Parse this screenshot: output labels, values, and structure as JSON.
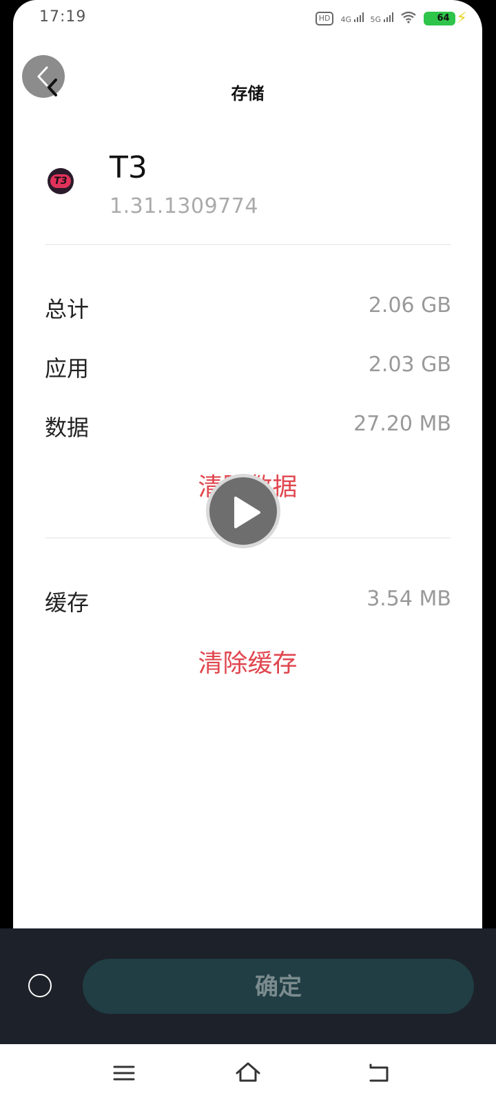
{
  "status_bar": {
    "time": "17:19",
    "hd_label": "HD",
    "signal1_label": "4G",
    "signal2_label": "5G",
    "battery_level": "64"
  },
  "header": {
    "title": "存储"
  },
  "app": {
    "name": "T3",
    "version": "1.31.1309774",
    "icon_text": "T3"
  },
  "storage": {
    "rows": [
      {
        "label": "总计",
        "value": "2.06 GB"
      },
      {
        "label": "应用",
        "value": "2.03 GB"
      },
      {
        "label": "数据",
        "value": "27.20 MB"
      }
    ],
    "clear_data_label": "清除数据",
    "cache": {
      "label": "缓存",
      "value": "3.54 MB"
    },
    "clear_cache_label": "清除缓存"
  },
  "bottom": {
    "confirm_label": "确定"
  },
  "icons": {
    "back": "back-arrow-icon",
    "play": "play-icon",
    "nav_menu": "menu-icon",
    "nav_home": "home-icon",
    "nav_back": "back-icon"
  },
  "colors": {
    "accent_red": "#e0464e",
    "confirm_bg": "#203e44",
    "panel_bg": "#1d2129"
  }
}
